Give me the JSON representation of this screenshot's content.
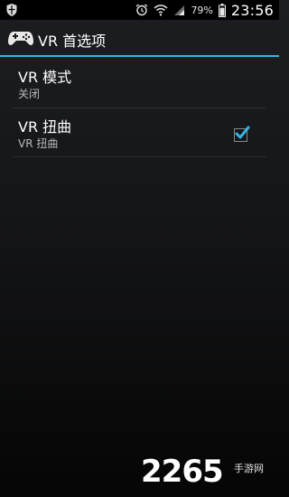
{
  "statusbar": {
    "battery_percent": "79%",
    "time": "23:56"
  },
  "actionbar": {
    "title": "VR 首选项"
  },
  "preferences": [
    {
      "title": "VR 模式",
      "summary": "关闭"
    },
    {
      "title": "VR 扭曲",
      "summary": "VR 扭曲",
      "checked": true
    }
  ],
  "watermark": {
    "number": "2265",
    "text": "手游网"
  },
  "colors": {
    "accent": "#33b5e5",
    "checkmark": "#33b5e5"
  }
}
